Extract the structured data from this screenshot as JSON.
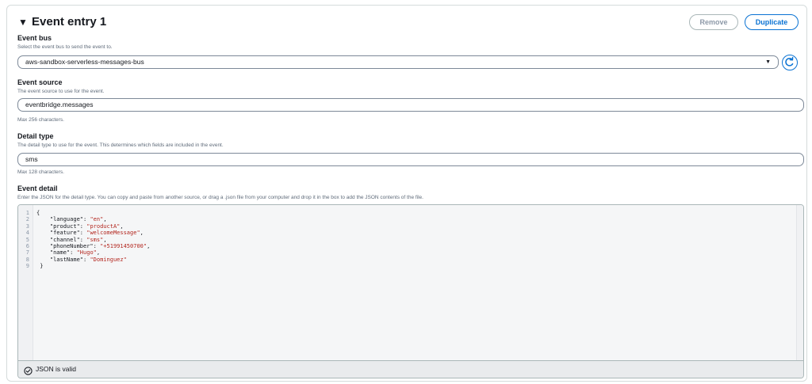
{
  "entry": {
    "title": "Event entry 1",
    "remove_label": "Remove",
    "duplicate_label": "Duplicate"
  },
  "event_bus": {
    "label": "Event bus",
    "description": "Select the event bus to send the event to.",
    "value": "aws-sandbox-serverless-messages-bus"
  },
  "event_source": {
    "label": "Event source",
    "description": "The event source to use for the event.",
    "value": "eventbridge.messages",
    "hint": "Max 256 characters."
  },
  "detail_type": {
    "label": "Detail type",
    "description": "The detail type to use for the event. This determines which fields are included in the event.",
    "value": "sms",
    "hint": "Max 128 characters."
  },
  "event_detail": {
    "label": "Event detail",
    "description": "Enter the JSON for the detail type. You can copy and paste from another source, or drag a .json file from your computer and drop it in the box to add the JSON contents of the file.",
    "line_numbers": [
      "1",
      "2",
      "3",
      "4",
      "5",
      "6",
      "7",
      "8",
      "9"
    ],
    "open_brace": "{",
    "close_brace": "}",
    "pairs": [
      {
        "key": "\"language\"",
        "value": "\"en\""
      },
      {
        "key": "\"product\"",
        "value": "\"productA\""
      },
      {
        "key": "\"feature\"",
        "value": "\"welcomeMessage\""
      },
      {
        "key": "\"channel\"",
        "value": "\"sms\""
      },
      {
        "key": "\"phoneNumber\"",
        "value": "\"+51991450700\""
      },
      {
        "key": "\"name\"",
        "value": "\"Hugo\""
      },
      {
        "key": "\"lastName\"",
        "value": "\"Dominguez\""
      }
    ],
    "status": "JSON is valid"
  },
  "icons": {
    "collapse": "caret-down-icon",
    "dropdown": "caret-down-icon",
    "refresh": "refresh-icon",
    "valid": "check-circle-icon"
  }
}
